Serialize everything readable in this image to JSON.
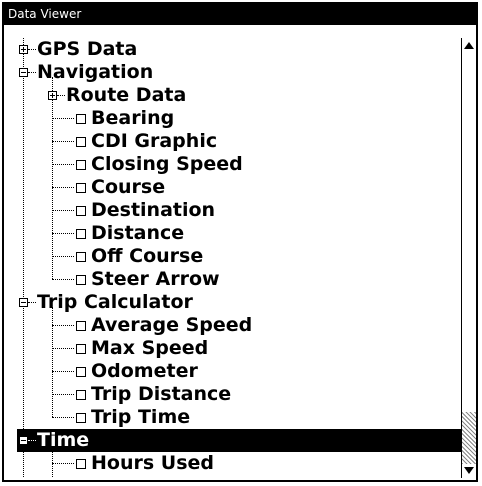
{
  "window": {
    "title": "Data Viewer"
  },
  "tree": {
    "items": [
      {
        "label": "GPS Data",
        "type": "folder",
        "expanded": false,
        "level": 0
      },
      {
        "label": "Navigation",
        "type": "folder",
        "expanded": true,
        "level": 0
      },
      {
        "label": "Route Data",
        "type": "folder",
        "expanded": false,
        "level": 1
      },
      {
        "label": "Bearing",
        "type": "item",
        "checked": false,
        "level": 1
      },
      {
        "label": "CDI Graphic",
        "type": "item",
        "checked": false,
        "level": 1
      },
      {
        "label": "Closing Speed",
        "type": "item",
        "checked": false,
        "level": 1
      },
      {
        "label": "Course",
        "type": "item",
        "checked": false,
        "level": 1
      },
      {
        "label": "Destination",
        "type": "item",
        "checked": false,
        "level": 1
      },
      {
        "label": "Distance",
        "type": "item",
        "checked": false,
        "level": 1
      },
      {
        "label": "Off Course",
        "type": "item",
        "checked": false,
        "level": 1
      },
      {
        "label": "Steer Arrow",
        "type": "item",
        "checked": false,
        "level": 1
      },
      {
        "label": "Trip Calculator",
        "type": "folder",
        "expanded": true,
        "level": 0
      },
      {
        "label": "Average Speed",
        "type": "item",
        "checked": false,
        "level": 1
      },
      {
        "label": "Max Speed",
        "type": "item",
        "checked": false,
        "level": 1
      },
      {
        "label": "Odometer",
        "type": "item",
        "checked": false,
        "level": 1
      },
      {
        "label": "Trip Distance",
        "type": "item",
        "checked": false,
        "level": 1
      },
      {
        "label": "Trip Time",
        "type": "item",
        "checked": false,
        "level": 1
      },
      {
        "label": "Time",
        "type": "folder",
        "expanded": true,
        "level": 0,
        "selected": true
      },
      {
        "label": "Hours Used",
        "type": "item",
        "checked": false,
        "level": 1
      }
    ]
  },
  "scrollbar": {
    "position": 0.0,
    "visible_fraction": 0.85
  }
}
